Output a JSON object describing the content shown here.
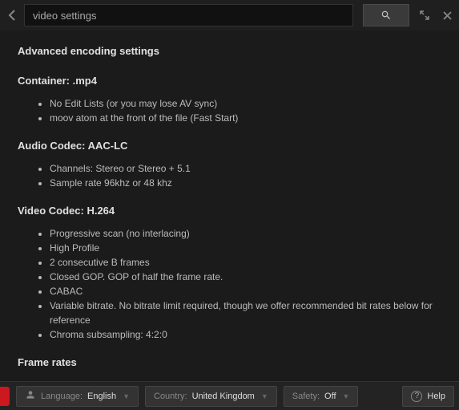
{
  "search": {
    "value": "video settings"
  },
  "content": {
    "heading": "Advanced encoding settings",
    "sections": [
      {
        "title": "Container: .mp4",
        "items": [
          "No Edit Lists (or you may lose AV sync)",
          "moov atom at the front of the file (Fast Start)"
        ]
      },
      {
        "title": "Audio Codec: AAC-LC",
        "items": [
          "Channels: Stereo or Stereo + 5.1",
          "Sample rate 96khz or 48 khz"
        ]
      },
      {
        "title": "Video Codec: H.264",
        "items": [
          "Progressive scan (no interlacing)",
          "High Profile",
          "2 consecutive B frames",
          "Closed GOP. GOP of half the frame rate.",
          "CABAC",
          "Variable bitrate. No bitrate limit required, though we offer recommended bit rates below for reference",
          "Chroma subsampling: 4:2:0"
        ]
      },
      {
        "title": "Frame rates",
        "items": []
      }
    ]
  },
  "footer": {
    "language": {
      "label": "Language:",
      "value": "English"
    },
    "country": {
      "label": "Country:",
      "value": "United Kingdom"
    },
    "safety": {
      "label": "Safety:",
      "value": "Off"
    },
    "help": "Help"
  }
}
